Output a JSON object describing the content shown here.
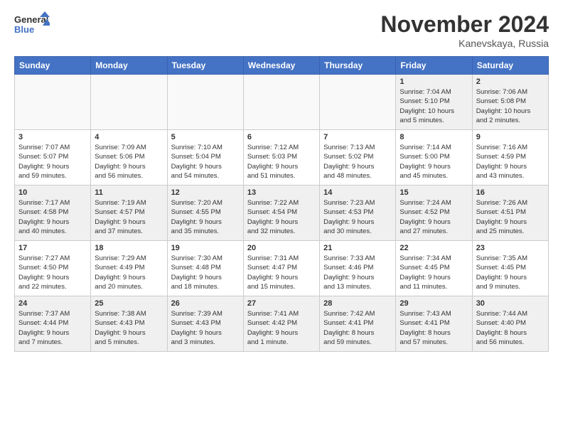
{
  "logo": {
    "line1": "General",
    "line2": "Blue"
  },
  "title": "November 2024",
  "location": "Kanevskaya, Russia",
  "weekdays": [
    "Sunday",
    "Monday",
    "Tuesday",
    "Wednesday",
    "Thursday",
    "Friday",
    "Saturday"
  ],
  "weeks": [
    [
      {
        "day": "",
        "info": ""
      },
      {
        "day": "",
        "info": ""
      },
      {
        "day": "",
        "info": ""
      },
      {
        "day": "",
        "info": ""
      },
      {
        "day": "",
        "info": ""
      },
      {
        "day": "1",
        "info": "Sunrise: 7:04 AM\nSunset: 5:10 PM\nDaylight: 10 hours\nand 5 minutes."
      },
      {
        "day": "2",
        "info": "Sunrise: 7:06 AM\nSunset: 5:08 PM\nDaylight: 10 hours\nand 2 minutes."
      }
    ],
    [
      {
        "day": "3",
        "info": "Sunrise: 7:07 AM\nSunset: 5:07 PM\nDaylight: 9 hours\nand 59 minutes."
      },
      {
        "day": "4",
        "info": "Sunrise: 7:09 AM\nSunset: 5:06 PM\nDaylight: 9 hours\nand 56 minutes."
      },
      {
        "day": "5",
        "info": "Sunrise: 7:10 AM\nSunset: 5:04 PM\nDaylight: 9 hours\nand 54 minutes."
      },
      {
        "day": "6",
        "info": "Sunrise: 7:12 AM\nSunset: 5:03 PM\nDaylight: 9 hours\nand 51 minutes."
      },
      {
        "day": "7",
        "info": "Sunrise: 7:13 AM\nSunset: 5:02 PM\nDaylight: 9 hours\nand 48 minutes."
      },
      {
        "day": "8",
        "info": "Sunrise: 7:14 AM\nSunset: 5:00 PM\nDaylight: 9 hours\nand 45 minutes."
      },
      {
        "day": "9",
        "info": "Sunrise: 7:16 AM\nSunset: 4:59 PM\nDaylight: 9 hours\nand 43 minutes."
      }
    ],
    [
      {
        "day": "10",
        "info": "Sunrise: 7:17 AM\nSunset: 4:58 PM\nDaylight: 9 hours\nand 40 minutes."
      },
      {
        "day": "11",
        "info": "Sunrise: 7:19 AM\nSunset: 4:57 PM\nDaylight: 9 hours\nand 37 minutes."
      },
      {
        "day": "12",
        "info": "Sunrise: 7:20 AM\nSunset: 4:55 PM\nDaylight: 9 hours\nand 35 minutes."
      },
      {
        "day": "13",
        "info": "Sunrise: 7:22 AM\nSunset: 4:54 PM\nDaylight: 9 hours\nand 32 minutes."
      },
      {
        "day": "14",
        "info": "Sunrise: 7:23 AM\nSunset: 4:53 PM\nDaylight: 9 hours\nand 30 minutes."
      },
      {
        "day": "15",
        "info": "Sunrise: 7:24 AM\nSunset: 4:52 PM\nDaylight: 9 hours\nand 27 minutes."
      },
      {
        "day": "16",
        "info": "Sunrise: 7:26 AM\nSunset: 4:51 PM\nDaylight: 9 hours\nand 25 minutes."
      }
    ],
    [
      {
        "day": "17",
        "info": "Sunrise: 7:27 AM\nSunset: 4:50 PM\nDaylight: 9 hours\nand 22 minutes."
      },
      {
        "day": "18",
        "info": "Sunrise: 7:29 AM\nSunset: 4:49 PM\nDaylight: 9 hours\nand 20 minutes."
      },
      {
        "day": "19",
        "info": "Sunrise: 7:30 AM\nSunset: 4:48 PM\nDaylight: 9 hours\nand 18 minutes."
      },
      {
        "day": "20",
        "info": "Sunrise: 7:31 AM\nSunset: 4:47 PM\nDaylight: 9 hours\nand 15 minutes."
      },
      {
        "day": "21",
        "info": "Sunrise: 7:33 AM\nSunset: 4:46 PM\nDaylight: 9 hours\nand 13 minutes."
      },
      {
        "day": "22",
        "info": "Sunrise: 7:34 AM\nSunset: 4:45 PM\nDaylight: 9 hours\nand 11 minutes."
      },
      {
        "day": "23",
        "info": "Sunrise: 7:35 AM\nSunset: 4:45 PM\nDaylight: 9 hours\nand 9 minutes."
      }
    ],
    [
      {
        "day": "24",
        "info": "Sunrise: 7:37 AM\nSunset: 4:44 PM\nDaylight: 9 hours\nand 7 minutes."
      },
      {
        "day": "25",
        "info": "Sunrise: 7:38 AM\nSunset: 4:43 PM\nDaylight: 9 hours\nand 5 minutes."
      },
      {
        "day": "26",
        "info": "Sunrise: 7:39 AM\nSunset: 4:43 PM\nDaylight: 9 hours\nand 3 minutes."
      },
      {
        "day": "27",
        "info": "Sunrise: 7:41 AM\nSunset: 4:42 PM\nDaylight: 9 hours\nand 1 minute."
      },
      {
        "day": "28",
        "info": "Sunrise: 7:42 AM\nSunset: 4:41 PM\nDaylight: 8 hours\nand 59 minutes."
      },
      {
        "day": "29",
        "info": "Sunrise: 7:43 AM\nSunset: 4:41 PM\nDaylight: 8 hours\nand 57 minutes."
      },
      {
        "day": "30",
        "info": "Sunrise: 7:44 AM\nSunset: 4:40 PM\nDaylight: 8 hours\nand 56 minutes."
      }
    ]
  ]
}
